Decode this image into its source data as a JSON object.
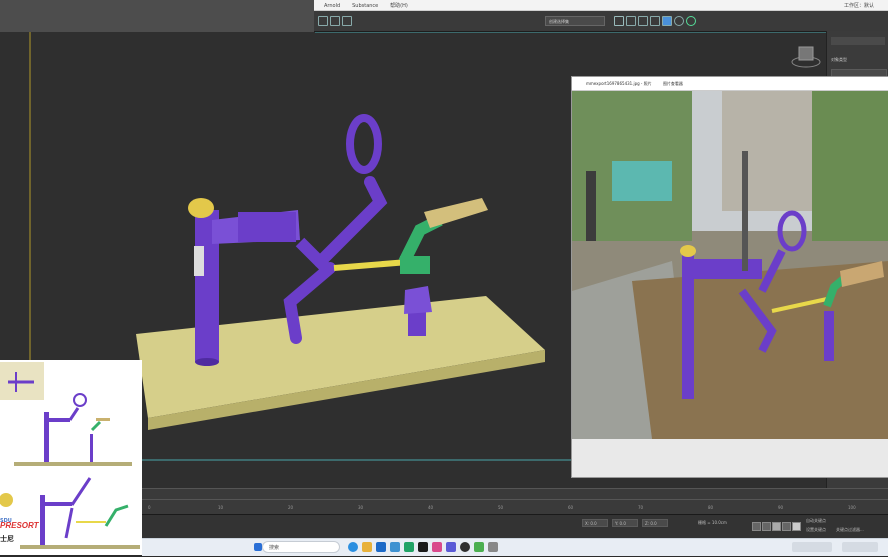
{
  "menubar": {
    "items": [
      "Arnold",
      "Substance",
      "帮助(H)"
    ],
    "right_label": "工作区：默认"
  },
  "toolbar": {
    "view_selector": "创建选择集"
  },
  "command_panel": {
    "label": "对象类型"
  },
  "photo_viewer": {
    "title": "mmexport1697865431.jpg - 照片",
    "subtitle": "图片查看器"
  },
  "timeline": {
    "ticks": [
      "0",
      "10",
      "20",
      "30",
      "40",
      "50",
      "60",
      "70",
      "80",
      "90",
      "100"
    ]
  },
  "statusbar": {
    "coord_x": "X: 0.0",
    "coord_y": "Y: 0.0",
    "coord_z": "Z: 0.0",
    "grid": "栅格 = 10.0cm",
    "autokey": "自动关键点",
    "setkey": "设置关键点",
    "filter": "关键点过滤器..."
  },
  "taskbar": {
    "search_placeholder": "搜索"
  },
  "reference": {
    "brand_text": "PRESORT",
    "brand_small": "SDU",
    "brand_cn": "士尼"
  },
  "colors": {
    "purple": "#6b3ec9",
    "green": "#35b06a",
    "yellow": "#e8d84a",
    "base": "#d6cf8a"
  }
}
